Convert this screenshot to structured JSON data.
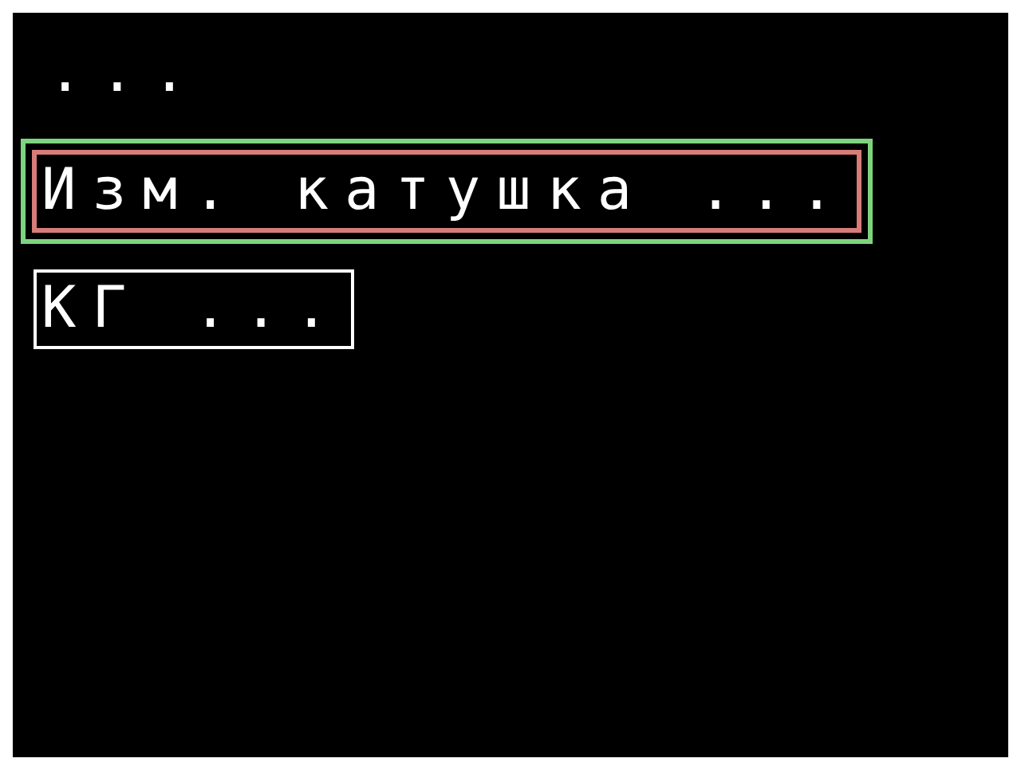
{
  "header": {
    "label": "..."
  },
  "menu": [
    {
      "label": "Изм. катушка ...",
      "selected": true
    },
    {
      "label": "КГ ...",
      "selected": false
    }
  ]
}
